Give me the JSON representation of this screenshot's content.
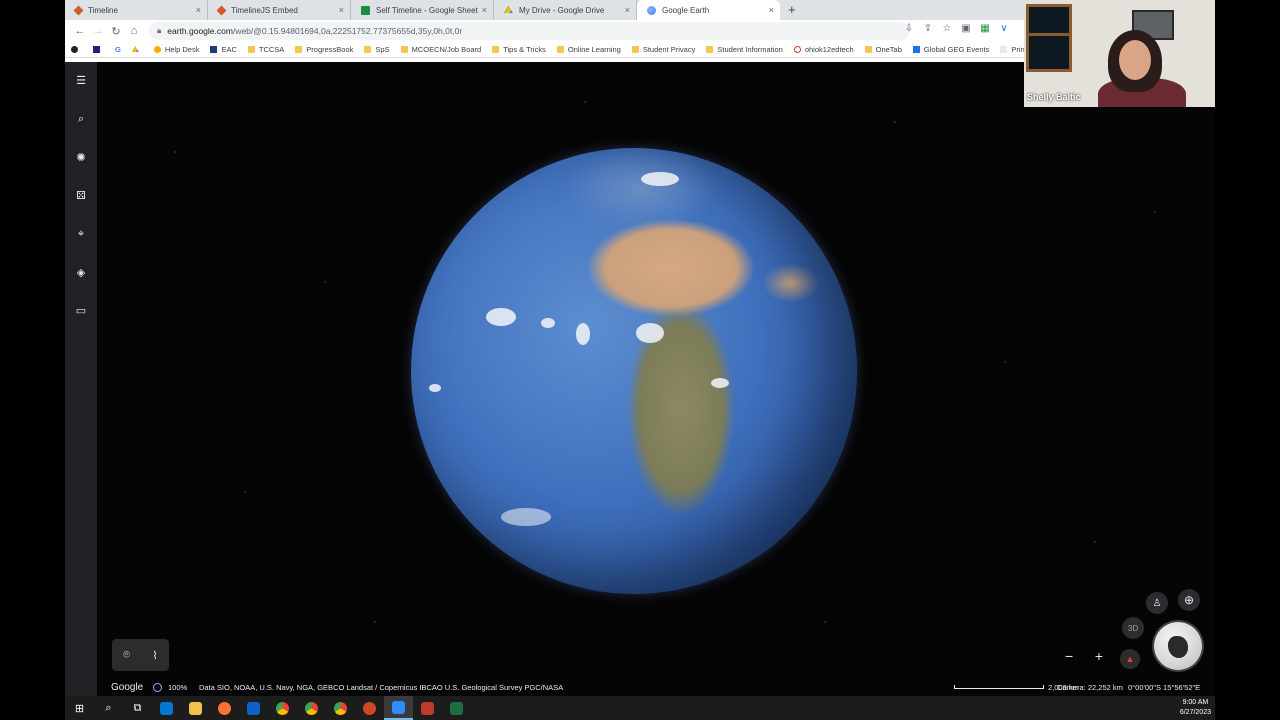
{
  "browser": {
    "tabs": [
      {
        "title": "Timeline",
        "icon": "timeline-icon",
        "color": "#d35b2a"
      },
      {
        "title": "TimelineJS Embed",
        "icon": "timeline-icon",
        "color": "#d35b2a"
      },
      {
        "title": "Self Timeline - Google Sheets",
        "icon": "sheets-icon",
        "color": "#1e8e3e"
      },
      {
        "title": "My Drive - Google Drive",
        "icon": "drive-icon",
        "color": "#fbbc04"
      },
      {
        "title": "Google Earth",
        "icon": "earth-icon",
        "color": "#4285f4",
        "active": true
      }
    ],
    "new_tab": "+",
    "tab_close": "×",
    "url_host": "earth.google.com",
    "url_path": "/web/@0.15.94801694,0a,22251752.77375655d,35y,0h,0t,0r",
    "bookmarks": [
      {
        "label": "",
        "type": "app"
      },
      {
        "label": "",
        "type": "app"
      },
      {
        "label": "G",
        "type": "app"
      },
      {
        "label": "",
        "type": "app"
      },
      {
        "label": "Help Desk",
        "type": "link"
      },
      {
        "label": "EAC",
        "type": "link"
      },
      {
        "label": "TCCSA",
        "type": "folder"
      },
      {
        "label": "ProgressBook",
        "type": "folder"
      },
      {
        "label": "SpS",
        "type": "folder"
      },
      {
        "label": "MCOECN/Job Board",
        "type": "folder"
      },
      {
        "label": "Tips & Tricks",
        "type": "folder"
      },
      {
        "label": "Online Learning",
        "type": "folder"
      },
      {
        "label": "Student Privacy",
        "type": "folder"
      },
      {
        "label": "Student Information",
        "type": "folder"
      },
      {
        "label": "ohiok12edtech",
        "type": "link"
      },
      {
        "label": "OneTab",
        "type": "folder"
      },
      {
        "label": "Global GEG Events",
        "type": "link"
      },
      {
        "label": "Print Cu",
        "type": "link"
      }
    ]
  },
  "earth": {
    "google_logo": "Google",
    "progress": "100%",
    "credits": "Data SIO, NOAA, U.S. Navy, NGA, GEBCO  Landsat / Copernicus  IBCAO  U.S. Geological Survey  PGC/NASA",
    "scale": "2,000 km",
    "camera": "Camera: 22,252 km",
    "coords": "0°00'00\"S 15°56'52\"E",
    "btn_3d": "3D"
  },
  "webcam": {
    "name": "Shelly Baltic"
  },
  "taskbar": {
    "time": "9:00 AM",
    "date": "6/27/2023"
  }
}
